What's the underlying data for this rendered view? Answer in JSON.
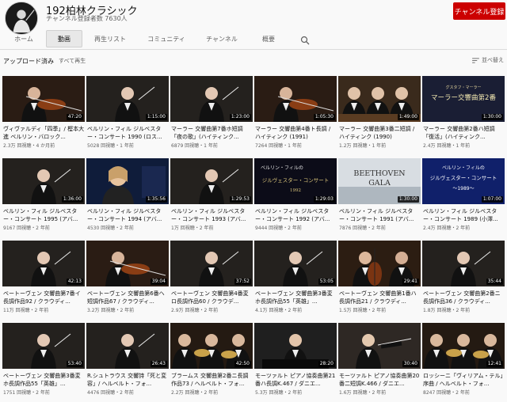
{
  "channel": {
    "title": "192柏林クラシック",
    "subscribers": "チャンネル登録者数 7630人",
    "subscribe_label": "チャンネル登録"
  },
  "tabs": [
    {
      "label": "ホーム"
    },
    {
      "label": "動画"
    },
    {
      "label": "再生リスト"
    },
    {
      "label": "コミュニティ"
    },
    {
      "label": "チャンネル"
    },
    {
      "label": "概要"
    }
  ],
  "section": {
    "title": "アップロード済み",
    "play_all": "すべて再生",
    "sort_label": "並べ替え"
  },
  "videos": [
    {
      "title": "ヴィヴァルディ「四季」/ 樫本大進 ベルリン・バロック...",
      "duration": "47:20",
      "meta": "2.3万 回視聴・4 か月前",
      "theme": "violin"
    },
    {
      "title": "ベルリン・フィル ジルベスター・コンサート 1990 (ロス...",
      "duration": "1:15:00",
      "meta": "5028 回視聴・1 年前",
      "theme": "conductor"
    },
    {
      "title": "マーラー 交響曲第7番ホ短調「夜の歌」(ハイティンク...",
      "duration": "1:23:00",
      "meta": "6879 回視聴・1 年前",
      "theme": "conductor"
    },
    {
      "title": "マーラー 交響曲第4番ト長調 / ハイティンク (1991)",
      "duration": "1:05:30",
      "meta": "7264 回視聴・1 年前",
      "theme": "violin"
    },
    {
      "title": "マーラー 交響曲第3番二短調 / ハイティンク (1990)",
      "duration": "1:49:00",
      "meta": "1.2万 回視聴・1 年前",
      "theme": "orchestra"
    },
    {
      "title": "マーラー 交響曲第2番ハ短調「復活」(ハイティンク...",
      "duration": "1:30:00",
      "meta": "2.4万 回視聴・1 年前",
      "theme": "title2"
    },
    {
      "title": "ベルリン・フィル ジルベスター・コンサート 1995 (アバ...",
      "duration": "1:36:00",
      "meta": "9167 回視聴・2 年前",
      "theme": "conductor"
    },
    {
      "title": "ベルリン・フィル ジルベスター・コンサート 1994 (アバ...",
      "duration": "1:35:56",
      "meta": "4530 回視聴・2 年前",
      "theme": "singer"
    },
    {
      "title": "ベルリン・フィル ジルベスター・コンサート 1993 (アバ...",
      "duration": "1:29:53",
      "meta": "1万 回視聴・2 年前",
      "theme": "conductor"
    },
    {
      "title": "ベルリン・フィル ジルベスター・コンサート 1992 (アバ...",
      "duration": "1:29:03",
      "meta": "9444 回視聴・2 年前",
      "theme": "silvester"
    },
    {
      "title": "ベルリン・フィル ジルベスター・コンサート 1991 (アバ...",
      "duration": "1:30:00",
      "meta": "7876 回視聴・2 年前",
      "theme": "beethoven"
    },
    {
      "title": "ベルリン・フィル ジルベスター・コンサート 1989 (小澤...",
      "duration": "1:07:00",
      "meta": "2.4万 回視聴・2 年前",
      "theme": "silvester89"
    },
    {
      "title": "ベートーヴェン 交響曲第7番イ長調作品92 / クラウディ...",
      "duration": "42:13",
      "meta": "11万 回視聴・2 年前",
      "theme": "conductor"
    },
    {
      "title": "ベートーヴェン 交響曲第6番ヘ短調作品67 / クラウディ...",
      "duration": "39:04",
      "meta": "3.2万 回視聴・2 年前",
      "theme": "violin"
    },
    {
      "title": "ベートーヴェン 交響曲第4番変ロ長調作品60 / クラウデ...",
      "duration": "37:52",
      "meta": "2.9万 回視聴・2 年前",
      "theme": "conductor"
    },
    {
      "title": "ベートーヴェン 交響曲第3番変ホ長調作品55「英雄」...",
      "duration": "53:05",
      "meta": "4.1万 回視聴・2 年前",
      "theme": "conductor"
    },
    {
      "title": "ベートーヴェン 交響曲第1番ハ長調作品21 / クラウディ...",
      "duration": "29:41",
      "meta": "1.5万 回視聴・2 年前",
      "theme": "cello"
    },
    {
      "title": "ベートーヴェン 交響曲第2番ニ長調作品36 / クラウディ...",
      "duration": "35:44",
      "meta": "1.8万 回視聴・2 年前",
      "theme": "conductor"
    },
    {
      "title": "ベートーヴェン 交響曲第3番変ホ長調作品55「英雄」...",
      "duration": "53:40",
      "meta": "1751 回視聴・2 年前",
      "theme": "conductor"
    },
    {
      "title": "R.シュトラウス 交響詩「死と変容」/ ヘルベルト・フォ...",
      "duration": "26:43",
      "meta": "4476 回視聴・2 年前",
      "theme": "conductor"
    },
    {
      "title": "ブラームス 交響曲第2番ニ長調作品73 / ヘルベルト・フォ...",
      "duration": "42:50",
      "meta": "2.2万 回視聴・2 年前",
      "theme": "brass"
    },
    {
      "title": "モーツァルト ピアノ協奏曲第21番ハ長調K.467 / ダニエ...",
      "duration": "28:20",
      "meta": "5.3万 回視聴・2 年前",
      "theme": "pianist"
    },
    {
      "title": "モーツァルト ピアノ協奏曲第20番二短調K.466 / ダニエ...",
      "duration": "30:40",
      "meta": "1.6万 回視聴・2 年前",
      "theme": "baton"
    },
    {
      "title": "ロッシーニ「ヴィリアム・テル」序曲 / ヘルベルト・フォ...",
      "duration": "12:41",
      "meta": "8247 回視聴・2 年前",
      "theme": "brass"
    }
  ],
  "thumb_text": {
    "title2_line1": "マーラー交響曲第2番",
    "title2_small": "グスタフ・マーラー",
    "silvester_line1": "ベルリン・フィルの",
    "silvester_line2": "ジルヴェスター・コンサート",
    "silvester_year": "1992",
    "beethoven_line1": "BEETHOVEN",
    "beethoven_line2": "GALA",
    "silvester89_line1": "ベルリン・フィルの",
    "silvester89_line2": "ジルヴェスター・コンサート",
    "silvester89_year": "〜1989〜"
  },
  "colors": {
    "subscribe": "#cc0000",
    "duration_bg": "#000000"
  }
}
